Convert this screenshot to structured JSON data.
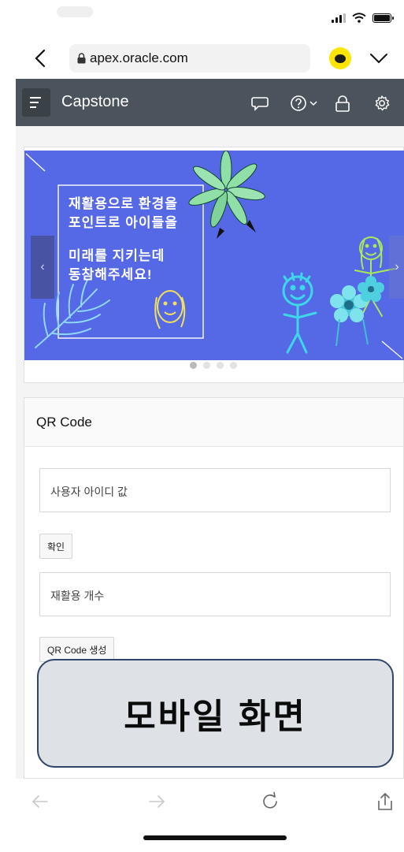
{
  "browser": {
    "url": "apex.oracle.com"
  },
  "header": {
    "title": "Capstone",
    "icons": [
      "chat-bubble-icon",
      "help-icon",
      "lock-icon",
      "gear-icon"
    ]
  },
  "banner": {
    "line1": "재활용으로 환경을",
    "line2": "포인트로 아이들을",
    "line3": "미래를 지키는데",
    "line4": "동참해주세요!",
    "prev_label": "‹",
    "next_label": "›",
    "slide_count": 4,
    "active_slide": 1
  },
  "qr_region": {
    "title": "QR Code",
    "user_id_field": "사용자 아이디 값",
    "confirm_button": "확인",
    "recycle_count_field": "재활용 개수",
    "generate_button": "QR Code 생성"
  },
  "overlay": {
    "label": "모바일 화면"
  },
  "colors": {
    "header_bg": "#4b545c",
    "banner_bg": "#5568e6",
    "kakao_yellow": "#ffe500",
    "overlay_border": "#2e466a"
  }
}
